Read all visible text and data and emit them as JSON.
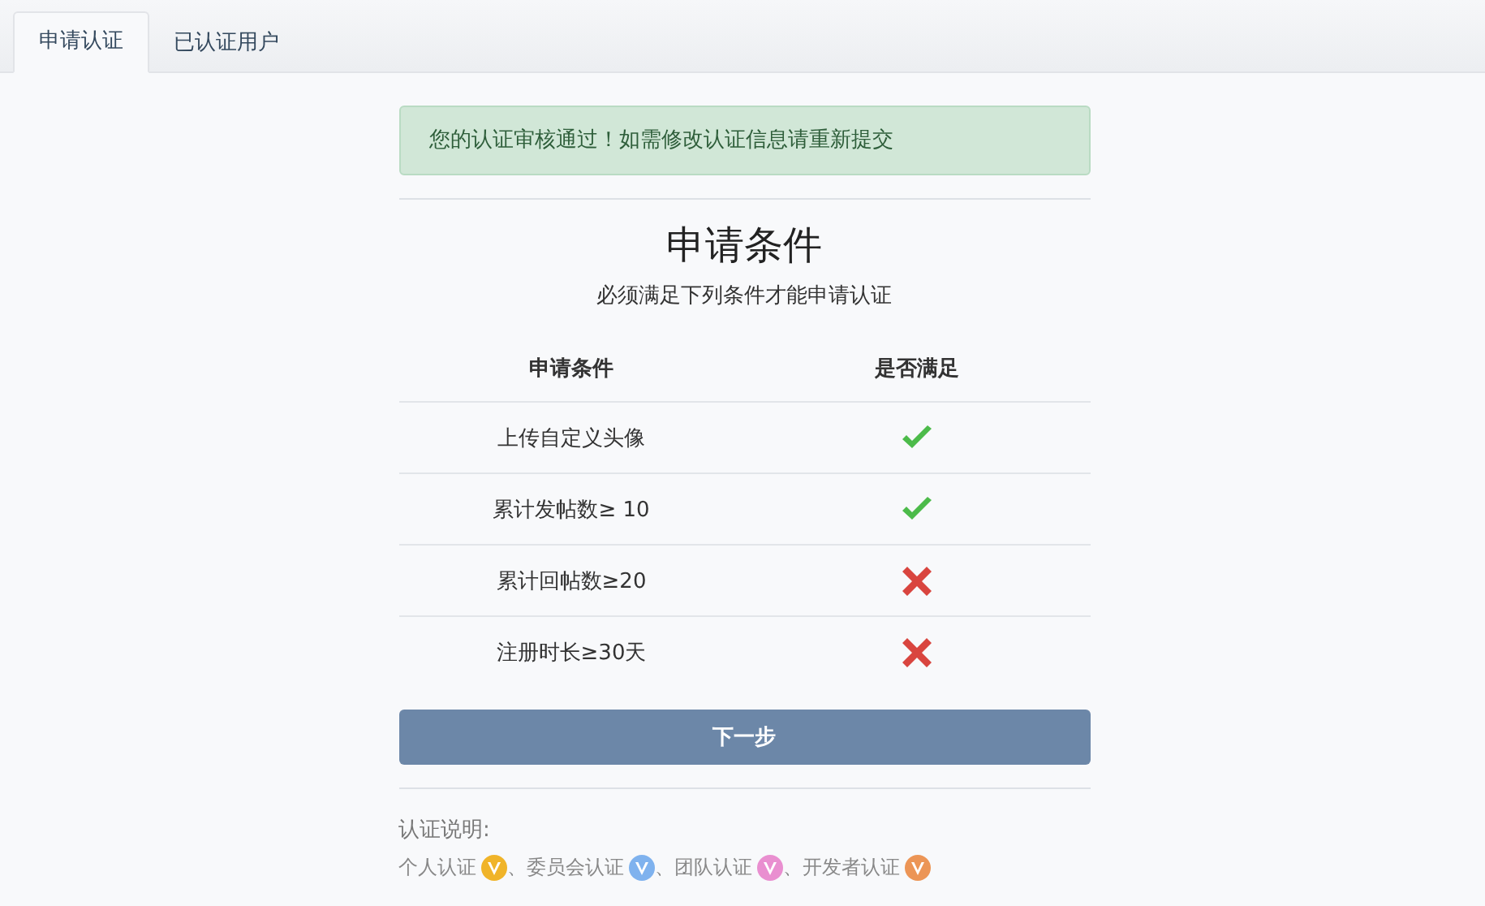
{
  "tabs": [
    {
      "label": "申请认证",
      "selected": true
    },
    {
      "label": "已认证用户",
      "selected": false
    }
  ],
  "alert": "您的认证审核通过！如需修改认证信息请重新提交",
  "title": "申请条件",
  "subtitle": "必须满足下列条件才能申请认证",
  "table": {
    "columns": [
      "申请条件",
      "是否满足"
    ],
    "rows": [
      {
        "condition": "上传自定义头像",
        "met": true
      },
      {
        "condition": "累计发帖数≥ 10",
        "met": true
      },
      {
        "condition": "累计回帖数≥20",
        "met": false
      },
      {
        "condition": "注册时长≥30天",
        "met": false
      }
    ]
  },
  "next_button": "下一步",
  "notes": {
    "heading": "认证说明:",
    "types": [
      {
        "label": "个人认证",
        "color": "#f0b429"
      },
      {
        "sep": "、",
        "label": "委员会认证",
        "color": "#7fb2ee"
      },
      {
        "sep": "、",
        "label": "团队认证",
        "color": "#e98fd0"
      },
      {
        "sep": "、",
        "label": "开发者认证",
        "color": "#ec9556"
      }
    ]
  }
}
